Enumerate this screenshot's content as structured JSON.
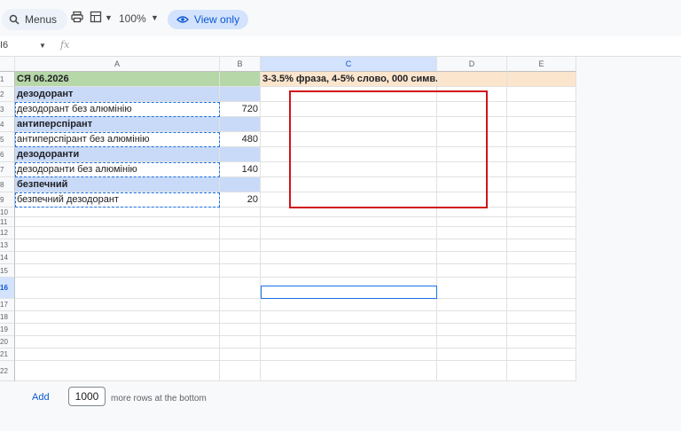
{
  "toolbar": {
    "menus_label": "Menus",
    "zoom": "100%",
    "view_only_label": "View only"
  },
  "formula_bar": {
    "name_box": "I6",
    "fx": "fx",
    "content": ""
  },
  "columns": [
    "A",
    "B",
    "C",
    "D",
    "E"
  ],
  "row_numbers": [
    "1",
    "2",
    "3",
    "4",
    "5",
    "6",
    "7",
    "8",
    "9",
    "10",
    "11",
    "12",
    "13",
    "14",
    "15",
    "16",
    "17",
    "18",
    "19",
    "20",
    "21",
    "22"
  ],
  "cells": {
    "A1": "СЯ 06.2026",
    "C1": "3-3.5% фраза, 4-5% слово, 000 симв.",
    "A2": "дезодорант",
    "A3": "дезодорант без алюмінію",
    "B3": "720",
    "A4": "антиперспірант",
    "A5": "антиперспірант без алюмінію",
    "B5": "480",
    "A6": "дезодоранти",
    "A7": "дезодоранти без алюмінію",
    "B7": "140",
    "A8": "безпечний",
    "A9": "безпечний дезодорант",
    "B9": "20"
  },
  "colors": {
    "header_green": "#b6d7a8",
    "group_blue": "#c9daf8",
    "note_peach": "#fce5cd",
    "selection_blue": "#1a73e8",
    "annotation_red": "#d1131b"
  },
  "footer": {
    "add_label": "Add",
    "rows_value": "1000",
    "rows_suffix": "more rows at the bottom"
  }
}
